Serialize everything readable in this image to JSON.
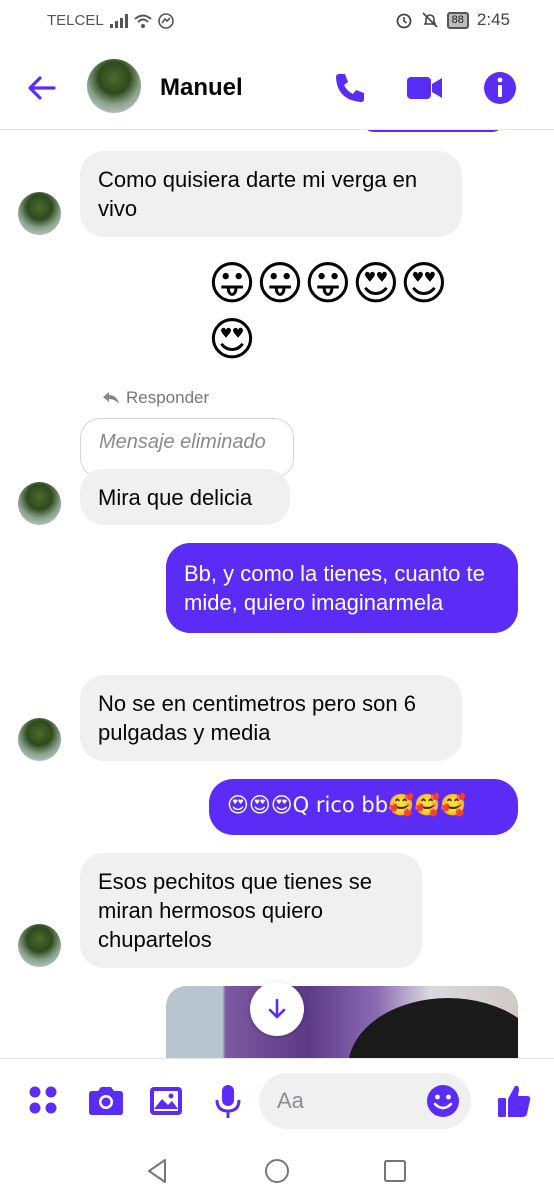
{
  "status_bar": {
    "carrier": "TELCEL",
    "battery": "88",
    "time": "2:45"
  },
  "header": {
    "contact_name": "Manuel"
  },
  "messages": {
    "m1": "Como quisiera darte mi verga en vivo",
    "m2_emojis": "😛😛😛😍😍",
    "m2_emojis_line2": "😍",
    "reply_label": "Responder",
    "deleted_label": "Mensaje eliminado",
    "m3": "Mira que delicia",
    "m4": "Bb, y como la tienes, cuanto te mide, quiero imaginarmela",
    "m5": "No se en centimetros pero son 6 pulgadas y media",
    "m6": "😍😍😍Q rico bb🥰🥰🥰",
    "m7": "Esos pechitos que tienes se miran hermosos quiero chupartelos"
  },
  "composer": {
    "placeholder": "Aa"
  },
  "colors": {
    "accent": "#5b2cf6",
    "incoming_bubble": "#f0f0f0"
  }
}
